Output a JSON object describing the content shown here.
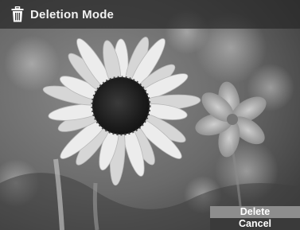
{
  "title_bar": {
    "icon": "trash-icon",
    "title": "Deletion Mode"
  },
  "photo": {
    "subject": "sunflower-photo"
  },
  "menu": {
    "items": [
      {
        "label": "Delete",
        "selected": true
      },
      {
        "label": "Cancel",
        "selected": false
      }
    ]
  },
  "colors": {
    "title_bar_bg": "#2a2a2a",
    "menu_selected_bg": "#8d8d8d",
    "menu_bg": "#3a3a3a",
    "text": "#ffffff"
  }
}
